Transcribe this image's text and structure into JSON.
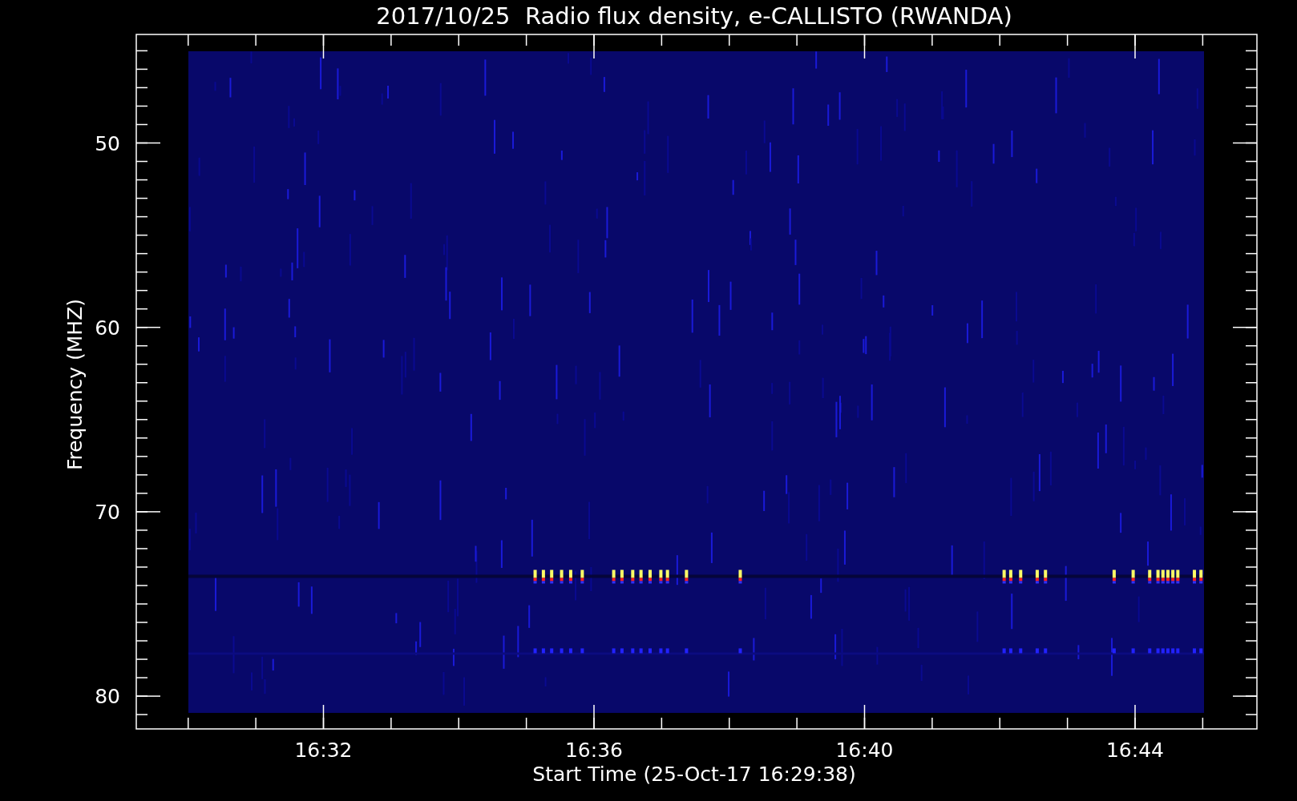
{
  "title": "2017/10/25  Radio flux density, e-CALLISTO (RWANDA)",
  "y_axis": {
    "label": "Frequency (MHZ)",
    "ticks": [
      "50",
      "60",
      "70",
      "80"
    ]
  },
  "x_axis": {
    "label": "Start Time (25-Oct-17 16:29:38)",
    "ticks": [
      "16:32",
      "16:36",
      "16:40",
      "16:44"
    ]
  }
}
